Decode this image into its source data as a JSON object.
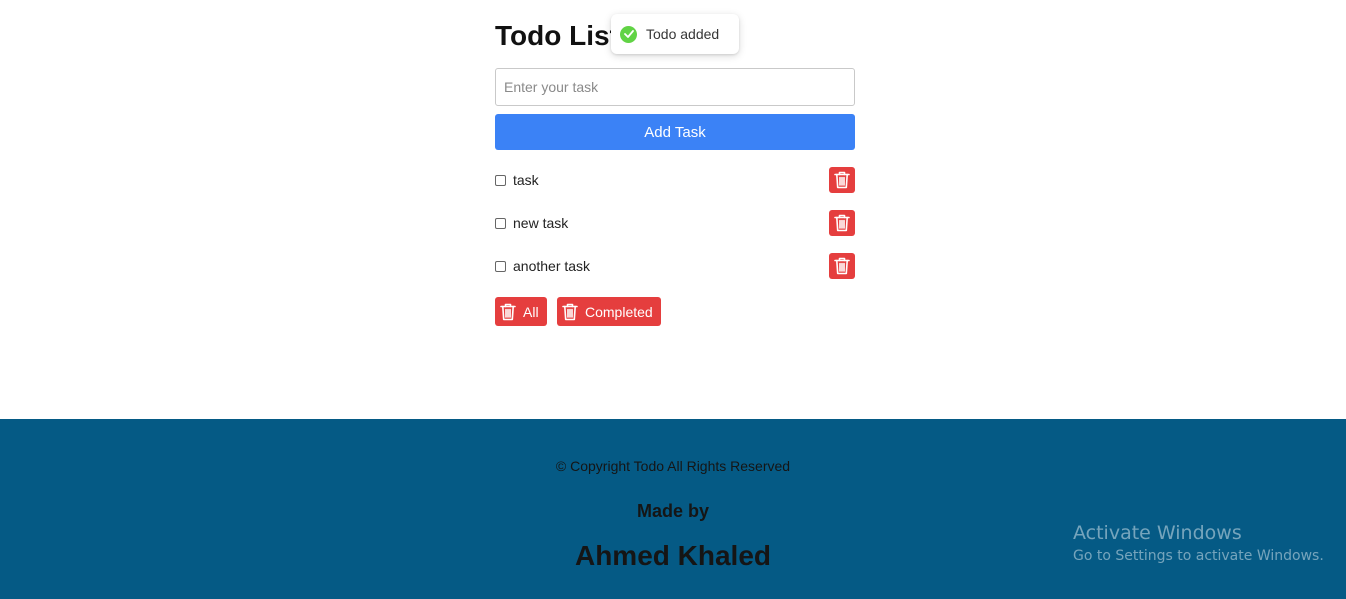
{
  "app": {
    "title": "Todo List",
    "input_placeholder": "Enter your task",
    "input_value": "",
    "add_button_label": "Add Task"
  },
  "todos": [
    {
      "label": "task",
      "checked": false
    },
    {
      "label": "new task",
      "checked": false
    },
    {
      "label": "another task",
      "checked": false
    }
  ],
  "bulk_actions": {
    "delete_all_label": "All",
    "delete_completed_label": "Completed"
  },
  "toast": {
    "message": "Todo added",
    "icon": "check-circle-icon"
  },
  "footer": {
    "copyright": "© Copyright Todo All Rights Reserved",
    "made_by_label": "Made by",
    "author": "Ahmed Khaled"
  },
  "watermark": {
    "title": "Activate Windows",
    "subtitle": "Go to Settings to activate Windows."
  },
  "colors": {
    "primary": "#3b82f6",
    "danger": "#e53e3e",
    "footer_bg": "#055a85",
    "success": "#61d345"
  }
}
